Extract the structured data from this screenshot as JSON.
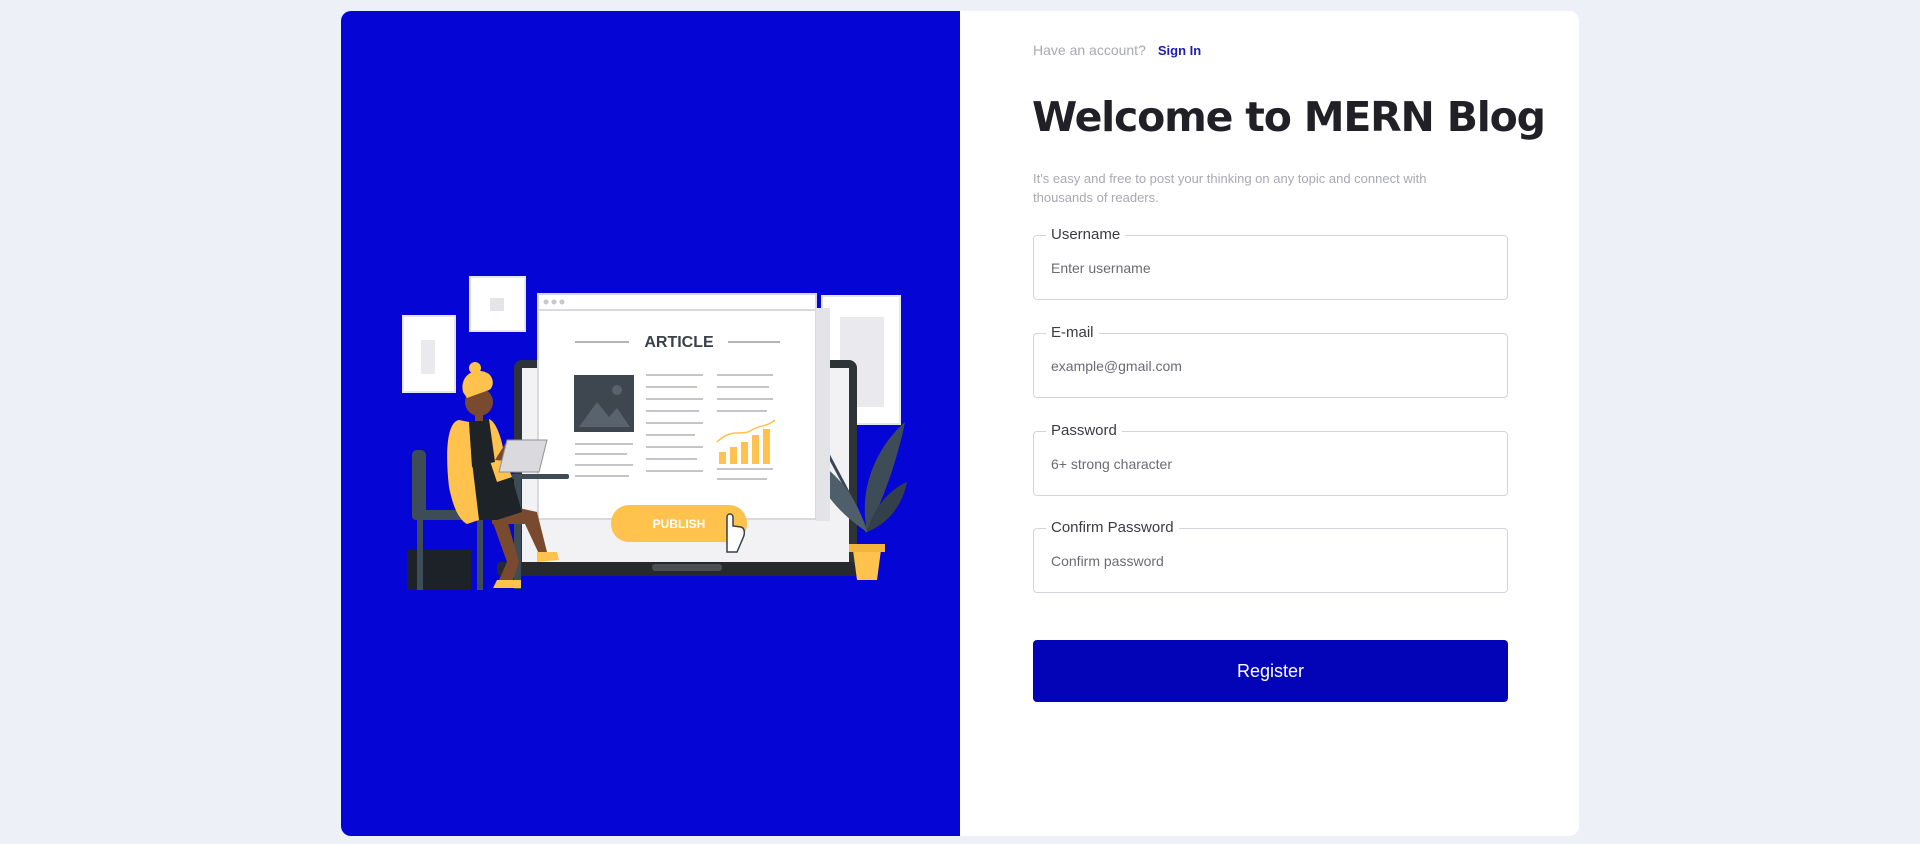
{
  "colors": {
    "page_background": "#eef0f8",
    "left_panel": "#0505d6",
    "button": "#0303b8",
    "link": "#1d1db8",
    "illustration_accent": "#ffc24d"
  },
  "header": {
    "account_prompt": "Have an account?",
    "sign_in_label": "Sign In"
  },
  "title": "Welcome to MERN Blog",
  "subtitle": "It's easy and free to post your thinking on any topic and connect with thousands of readers.",
  "illustration": {
    "article_label": "ARTICLE",
    "publish_label": "PUBLISH"
  },
  "form": {
    "username": {
      "label": "Username",
      "placeholder": "Enter username"
    },
    "email": {
      "label": "E-mail",
      "placeholder": "example@gmail.com"
    },
    "password": {
      "label": "Password",
      "placeholder": "6+ strong character"
    },
    "confirm_password": {
      "label": "Confirm Password",
      "placeholder": "Confirm password"
    },
    "submit_label": "Register"
  }
}
